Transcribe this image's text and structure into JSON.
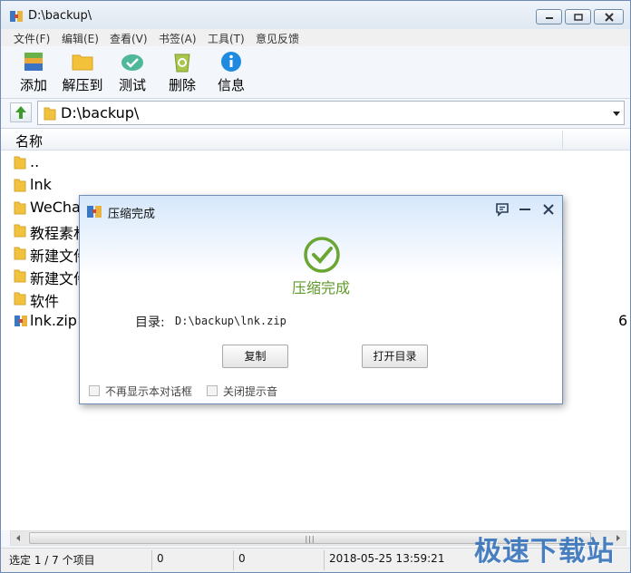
{
  "window": {
    "title": "D:\\backup\\"
  },
  "menu": [
    "文件(F)",
    "编辑(E)",
    "查看(V)",
    "书签(A)",
    "工具(T)",
    "意见反馈"
  ],
  "toolbar": {
    "add": "添加",
    "extract": "解压到",
    "test": "测试",
    "delete": "删除",
    "info": "信息"
  },
  "address": {
    "path": "D:\\backup\\"
  },
  "list": {
    "header_name": "名称",
    "rows": [
      "..",
      "lnk",
      "WeCha",
      "教程素材",
      "新建文件",
      "新建文件",
      "软件",
      "lnk.zip"
    ],
    "last_row_extra": "6"
  },
  "status": {
    "selection": "选定 1 / 7 个项目",
    "col2": "0",
    "col3": "0",
    "datetime": "2018-05-25 13:59:21"
  },
  "watermark": "极速下载站",
  "dialog": {
    "title": "压缩完成",
    "status": "压缩完成",
    "path_label": "目录:",
    "path_value": "D:\\backup\\lnk.zip",
    "copy_button": "复制",
    "open_button": "打开目录",
    "checkbox_1": "不再显示本对话框",
    "checkbox_2": "关闭提示音",
    "success_color": "#6aa632"
  }
}
